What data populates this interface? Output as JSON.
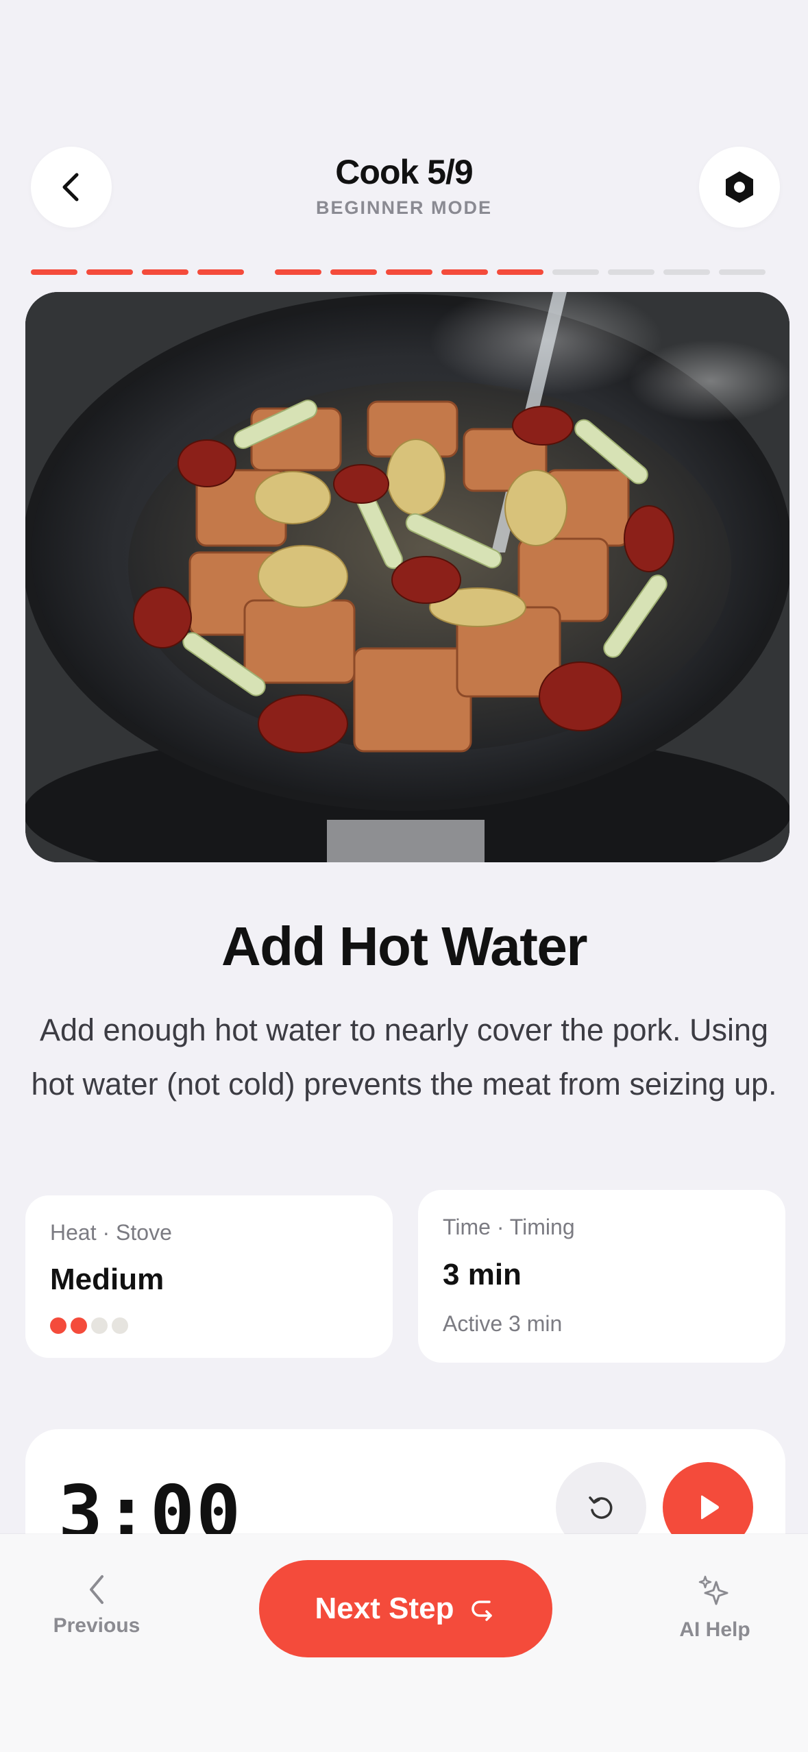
{
  "header": {
    "title": "Cook 5/9",
    "mode": "BEGINNER MODE",
    "back_icon": "chevron-left-icon",
    "settings_icon": "hexagon-gear-icon"
  },
  "progress": {
    "stages": [
      {
        "segments": 4,
        "completed": 4
      },
      {
        "segments": 9,
        "completed": 5
      }
    ],
    "accent": "#f44b3b",
    "inactive": "#dcdcdf"
  },
  "step": {
    "title": "Add Hot Water",
    "description": "Add enough hot water to nearly cover the pork. Using hot water (not cold) prevents the meat from seizing up."
  },
  "heat_card": {
    "label": "Heat · Stove",
    "value": "Medium",
    "level": 2,
    "max_level": 4
  },
  "time_card": {
    "label": "Time · Timing",
    "value": "3 min",
    "sub": "Active 3 min"
  },
  "timer": {
    "display": "3:00",
    "reset_icon": "reset-icon",
    "play_icon": "play-icon"
  },
  "bottom_nav": {
    "previous_label": "Previous",
    "next_label": "Next Step",
    "ai_label": "AI Help"
  },
  "colors": {
    "accent": "#f44b3b",
    "background": "#f2f1f6"
  }
}
